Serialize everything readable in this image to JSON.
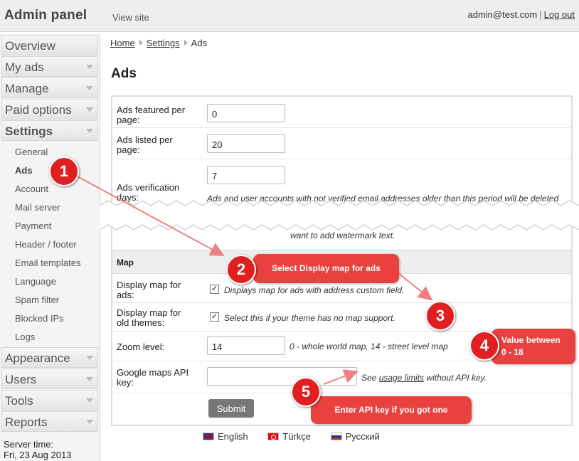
{
  "header": {
    "brand": "Admin panel",
    "view_site": "View site",
    "user_email": "admin@test.com",
    "separator": "|",
    "logout": "Log out"
  },
  "sidebar": {
    "sections": [
      {
        "label": "Overview"
      },
      {
        "label": "My ads"
      },
      {
        "label": "Manage"
      },
      {
        "label": "Paid options"
      },
      {
        "label": "Settings"
      }
    ],
    "settings_items": [
      "General",
      "Ads",
      "Account",
      "Mail server",
      "Payment",
      "Header / footer",
      "Email templates",
      "Language",
      "Spam filter",
      "Blocked IPs",
      "Logs"
    ],
    "sections_after": [
      {
        "label": "Appearance"
      },
      {
        "label": "Users"
      },
      {
        "label": "Tools"
      },
      {
        "label": "Reports"
      }
    ],
    "server_time_label": "Server time:",
    "server_time_value": "Fri, 23 Aug 2013"
  },
  "breadcrumb": {
    "home": "Home",
    "settings": "Settings",
    "current": "Ads"
  },
  "page_title": "Ads",
  "form": {
    "featured_label": "Ads featured per page:",
    "featured_value": "0",
    "listed_label": "Ads listed per page:",
    "listed_value": "20",
    "verification_label": "Ads verification days:",
    "verification_value": "7",
    "verification_hint": "Ads and user accounts with not verified email addresses older than this period will be deleted from system.",
    "watermark_hint": "want to add watermark text.",
    "map_section": "Map",
    "display_map_label": "Display map for ads:",
    "display_map_hint": "Displays map for ads with address custom field.",
    "display_map_checked": true,
    "old_themes_label": "Display map for old themes:",
    "old_themes_hint": "Select this if your theme has no map support.",
    "old_themes_checked": true,
    "zoom_label": "Zoom level:",
    "zoom_value": "14",
    "zoom_hint": "0 - whole world map, 14 - street level map",
    "api_key_label": "Google maps API key:",
    "api_key_value": "",
    "api_hint_pre": "See",
    "api_hint_link": "usage limits",
    "api_hint_post": "without API key.",
    "submit": "Submit"
  },
  "languages": [
    "English",
    "Türkçe",
    "Русский"
  ],
  "annotations": {
    "step1": "1",
    "step2": "2",
    "step2_text": "Select Display map for ads",
    "step3": "3",
    "step4": "4",
    "step4_text_line1": "Value between",
    "step4_text_line2": "0 -  18",
    "step5": "5",
    "step5_text": "Enter API key if you got one",
    "color": "#e8413f"
  }
}
